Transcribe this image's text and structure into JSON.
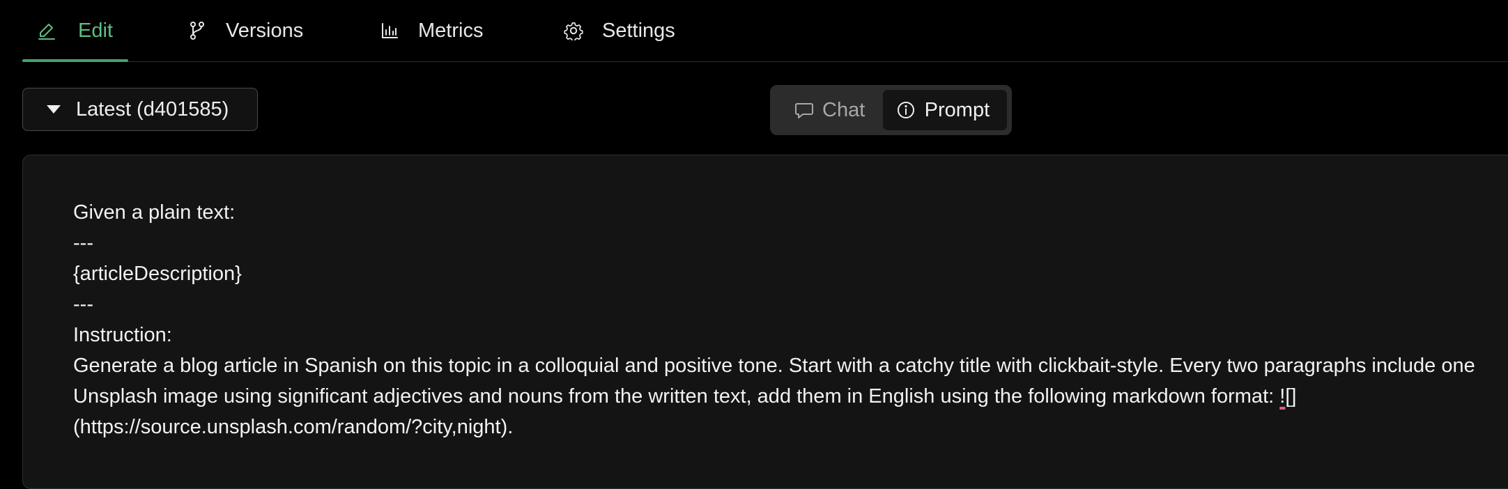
{
  "tabs": [
    {
      "label": "Edit",
      "icon": "pencil-icon",
      "active": true
    },
    {
      "label": "Versions",
      "icon": "branch-icon",
      "active": false
    },
    {
      "label": "Metrics",
      "icon": "bar-chart-icon",
      "active": false
    },
    {
      "label": "Settings",
      "icon": "gear-icon",
      "active": false
    }
  ],
  "version_select": {
    "value": "Latest (d401585)",
    "icon": "caret-down-icon"
  },
  "mode_toggle": {
    "chat_label": "Chat",
    "chat_icon": "chat-bubble-icon",
    "prompt_label": "Prompt",
    "prompt_icon": "info-circle-icon",
    "selected": "Prompt"
  },
  "editor": {
    "lines": [
      "Given a plain text:",
      "---",
      "{articleDescription}",
      "---",
      "Instruction:"
    ],
    "instruction_main": "Generate a blog article in Spanish on this topic in a colloquial and positive tone. Start with a catchy title with clickbait-style. Every two paragraphs include one Unsplash image using significant adjectives and nouns from the written text, add them in English using the following markdown format: ",
    "instruction_flagged": "!",
    "instruction_tail": "[](https://source.unsplash.com/random/?city,night)."
  },
  "colors": {
    "accent": "#5bbf86",
    "background": "#000000",
    "panel": "#141414",
    "spellcheck": "#e0607e"
  }
}
